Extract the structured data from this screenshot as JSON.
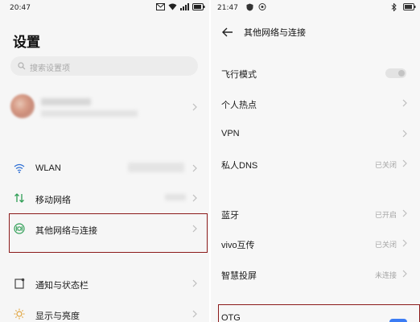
{
  "left": {
    "status_time": "20:47",
    "title": "设置",
    "search_placeholder": "搜索设置项",
    "items": [
      {
        "label": "WLAN",
        "icon": "wifi-icon"
      },
      {
        "label": "移动网络",
        "icon": "mobile-data-icon"
      },
      {
        "label": "其他网络与连接",
        "icon": "connections-icon"
      },
      {
        "label": "通知与状态栏",
        "icon": "notification-icon"
      },
      {
        "label": "显示与亮度",
        "icon": "brightness-icon"
      }
    ]
  },
  "right": {
    "status_time": "21:47",
    "title": "其他网络与连接",
    "items": [
      {
        "label": "飞行模式",
        "value": ""
      },
      {
        "label": "个人热点",
        "value": ""
      },
      {
        "label": "VPN",
        "value": ""
      },
      {
        "label": "私人DNS",
        "value": "已关闭"
      },
      {
        "label": "蓝牙",
        "value": "已开启"
      },
      {
        "label": "vivo互传",
        "value": "已关闭"
      },
      {
        "label": "智慧投屏",
        "value": "未连接"
      },
      {
        "label": "OTG",
        "value": ""
      }
    ]
  },
  "colors": {
    "highlight": "#8b1a1a",
    "accent": "#3b7cf4",
    "connections_icon": "#2f9e55"
  }
}
